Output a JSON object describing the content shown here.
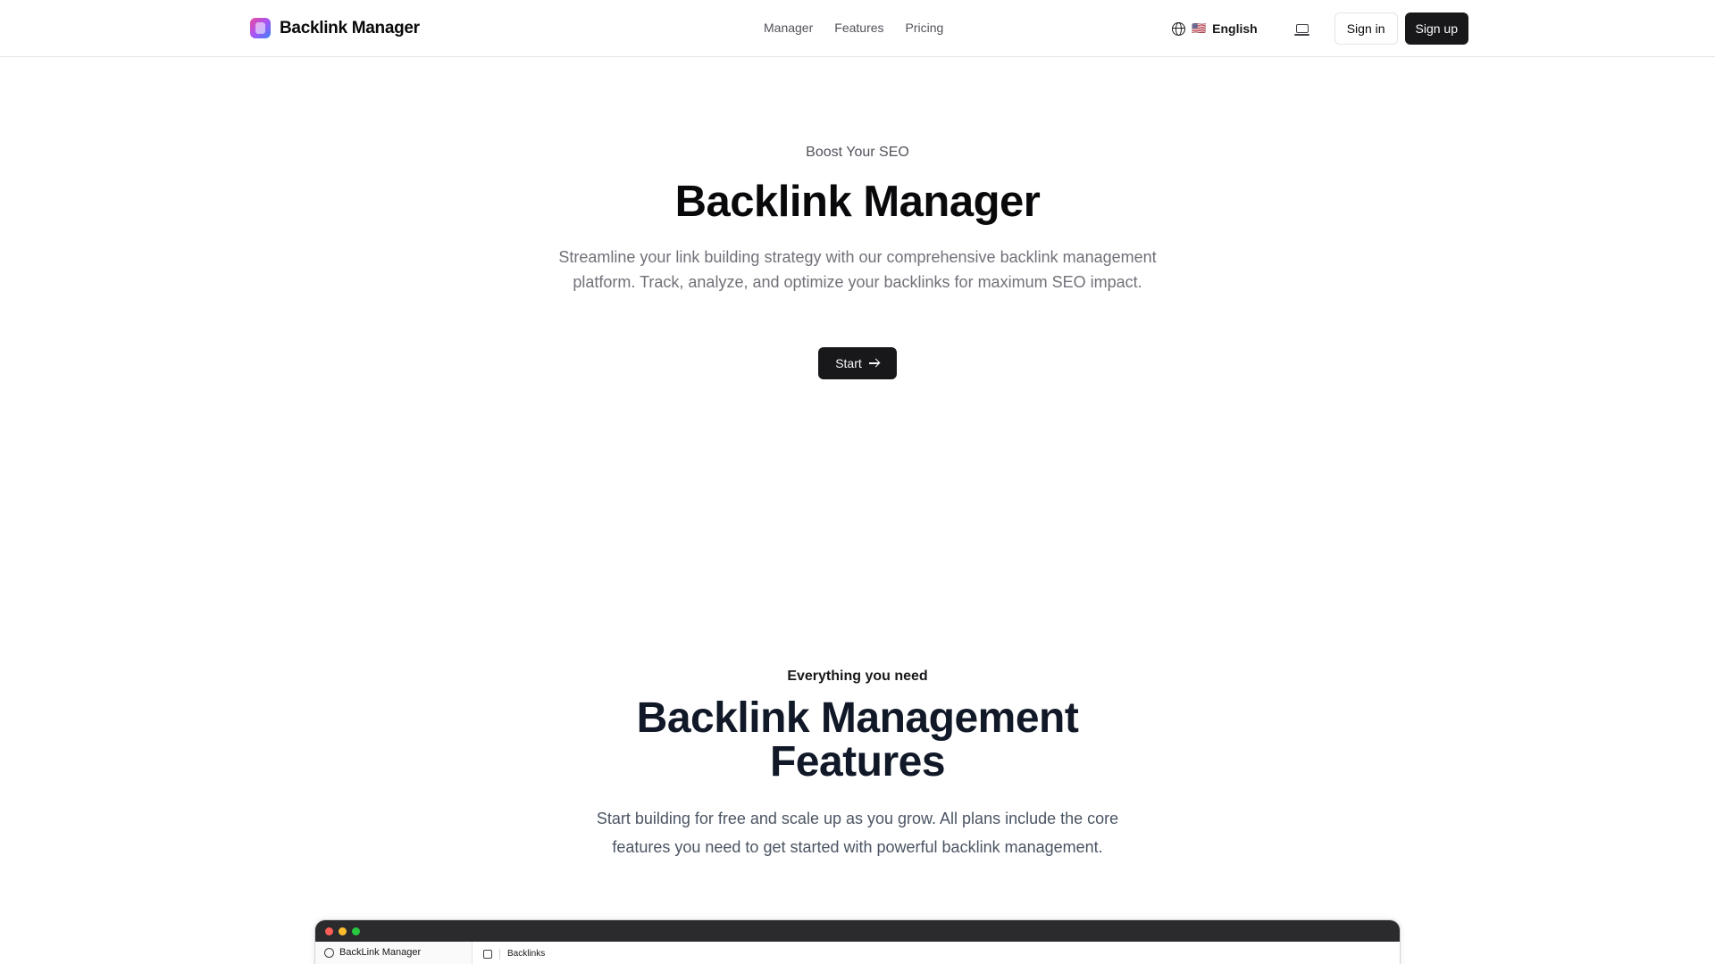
{
  "header": {
    "brand_name": "Backlink Manager",
    "nav": [
      {
        "label": "Manager"
      },
      {
        "label": "Features"
      },
      {
        "label": "Pricing"
      }
    ],
    "language_flag": "🇺🇸",
    "language_label": "English",
    "sign_in_label": "Sign in",
    "sign_up_label": "Sign up"
  },
  "hero": {
    "eyebrow": "Boost Your SEO",
    "title": "Backlink Manager",
    "description": "Streamline your link building strategy with our comprehensive backlink management platform. Track, analyze, and optimize your backlinks for maximum SEO impact.",
    "start_label": "Start"
  },
  "features": {
    "eyebrow": "Everything you need",
    "title": "Backlink Management Features",
    "description": "Start building for free and scale up as you grow. All plans include the core features you need to get started with powerful backlink management."
  },
  "preview": {
    "sidebar_title": "BackLink Manager",
    "breadcrumb": "Backlinks",
    "window_dots": [
      "#ff5f57",
      "#febc2e",
      "#28c840"
    ]
  },
  "colors": {
    "primary_dark": "#18181b",
    "muted_text": "#71717a",
    "border": "#e4e4e7"
  }
}
